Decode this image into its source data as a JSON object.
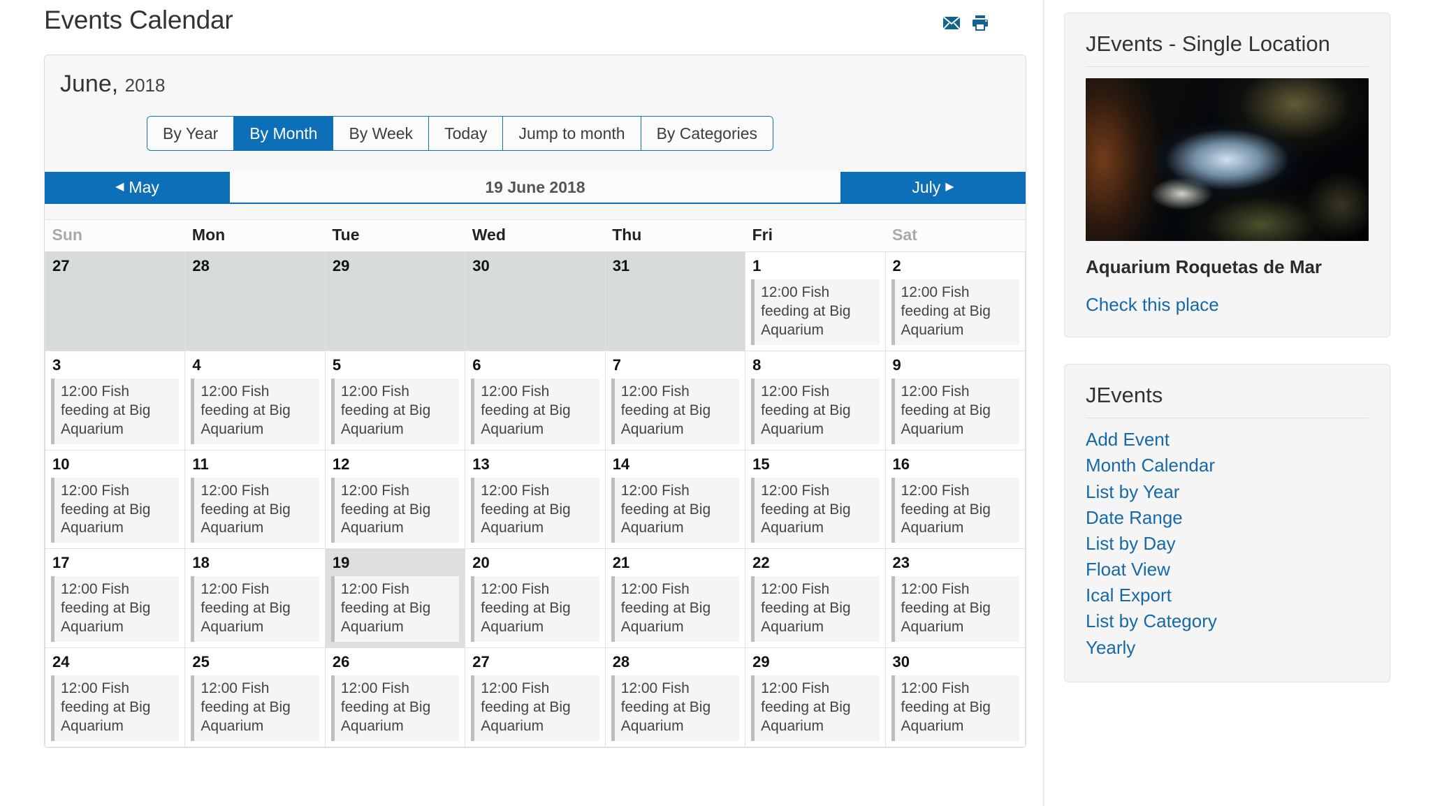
{
  "header": {
    "title": "Events Calendar",
    "email_icon": "envelope-icon",
    "print_icon": "printer-icon"
  },
  "calendar": {
    "month_label": "June,",
    "year_label": "2018",
    "view_buttons": [
      {
        "label": "By Year",
        "active": false
      },
      {
        "label": "By Month",
        "active": true
      },
      {
        "label": "By Week",
        "active": false
      },
      {
        "label": "Today",
        "active": false
      },
      {
        "label": "Jump to month",
        "active": false
      },
      {
        "label": "By Categories",
        "active": false
      }
    ],
    "nav": {
      "prev_label": "May",
      "current_label": "19 June 2018",
      "next_label": "July"
    },
    "weekdays": [
      {
        "label": "Sun",
        "weekend": true
      },
      {
        "label": "Mon",
        "weekend": false
      },
      {
        "label": "Tue",
        "weekend": false
      },
      {
        "label": "Wed",
        "weekend": false
      },
      {
        "label": "Thu",
        "weekend": false
      },
      {
        "label": "Fri",
        "weekend": false
      },
      {
        "label": "Sat",
        "weekend": true
      }
    ],
    "event_text": "12:00 Fish feeding at Big Aquarium",
    "weeks": [
      [
        {
          "day": "27",
          "other": true,
          "today": false,
          "event": false
        },
        {
          "day": "28",
          "other": true,
          "today": false,
          "event": false
        },
        {
          "day": "29",
          "other": true,
          "today": false,
          "event": false
        },
        {
          "day": "30",
          "other": true,
          "today": false,
          "event": false
        },
        {
          "day": "31",
          "other": true,
          "today": false,
          "event": false
        },
        {
          "day": "1",
          "other": false,
          "today": false,
          "event": true
        },
        {
          "day": "2",
          "other": false,
          "today": false,
          "event": true
        }
      ],
      [
        {
          "day": "3",
          "other": false,
          "today": false,
          "event": true
        },
        {
          "day": "4",
          "other": false,
          "today": false,
          "event": true
        },
        {
          "day": "5",
          "other": false,
          "today": false,
          "event": true
        },
        {
          "day": "6",
          "other": false,
          "today": false,
          "event": true
        },
        {
          "day": "7",
          "other": false,
          "today": false,
          "event": true
        },
        {
          "day": "8",
          "other": false,
          "today": false,
          "event": true
        },
        {
          "day": "9",
          "other": false,
          "today": false,
          "event": true
        }
      ],
      [
        {
          "day": "10",
          "other": false,
          "today": false,
          "event": true
        },
        {
          "day": "11",
          "other": false,
          "today": false,
          "event": true
        },
        {
          "day": "12",
          "other": false,
          "today": false,
          "event": true
        },
        {
          "day": "13",
          "other": false,
          "today": false,
          "event": true
        },
        {
          "day": "14",
          "other": false,
          "today": false,
          "event": true
        },
        {
          "day": "15",
          "other": false,
          "today": false,
          "event": true
        },
        {
          "day": "16",
          "other": false,
          "today": false,
          "event": true
        }
      ],
      [
        {
          "day": "17",
          "other": false,
          "today": false,
          "event": true
        },
        {
          "day": "18",
          "other": false,
          "today": false,
          "event": true
        },
        {
          "day": "19",
          "other": false,
          "today": true,
          "event": true
        },
        {
          "day": "20",
          "other": false,
          "today": false,
          "event": true
        },
        {
          "day": "21",
          "other": false,
          "today": false,
          "event": true
        },
        {
          "day": "22",
          "other": false,
          "today": false,
          "event": true
        },
        {
          "day": "23",
          "other": false,
          "today": false,
          "event": true
        }
      ],
      [
        {
          "day": "24",
          "other": false,
          "today": false,
          "event": true
        },
        {
          "day": "25",
          "other": false,
          "today": false,
          "event": true
        },
        {
          "day": "26",
          "other": false,
          "today": false,
          "event": true
        },
        {
          "day": "27",
          "other": false,
          "today": false,
          "event": true
        },
        {
          "day": "28",
          "other": false,
          "today": false,
          "event": true
        },
        {
          "day": "29",
          "other": false,
          "today": false,
          "event": true
        },
        {
          "day": "30",
          "other": false,
          "today": false,
          "event": true
        }
      ]
    ]
  },
  "sidebar": {
    "location_module": {
      "title": "JEvents - Single Location",
      "image_alt": "aquarium-fish-photo",
      "location_name": "Aquarium Roquetas de Mar",
      "link_label": "Check this place"
    },
    "links_module": {
      "title": "JEvents",
      "items": [
        {
          "label": "Add Event"
        },
        {
          "label": "Month Calendar"
        },
        {
          "label": "List by Year"
        },
        {
          "label": "Date Range"
        },
        {
          "label": "List by Day"
        },
        {
          "label": "Float View"
        },
        {
          "label": "Ical Export"
        },
        {
          "label": "List by Category"
        },
        {
          "label": "Yearly"
        }
      ]
    }
  },
  "colors": {
    "accent_blue": "#0d6fb8",
    "link_blue": "#1669a6",
    "icon_blue": "#14628f",
    "other_month_bg": "#d8dbdc",
    "today_bg": "#dededf"
  }
}
